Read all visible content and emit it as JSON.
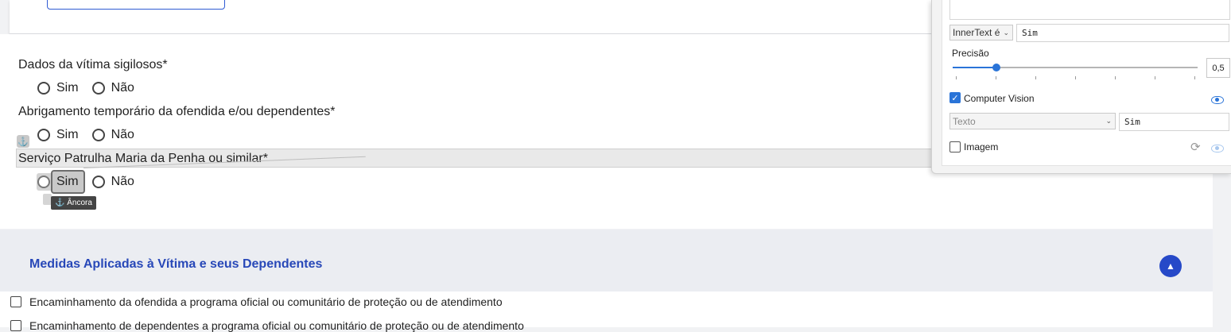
{
  "form": {
    "q1": {
      "label": "Dados da vítima sigilosos*",
      "yes": "Sim",
      "no": "Não"
    },
    "q2": {
      "label": "Abrigamento temporário da ofendida e/ou dependentes*",
      "yes": "Sim",
      "no": "Não"
    },
    "q3": {
      "label": "Serviço Patrulha Maria da Penha ou similar*",
      "yes": "Sim",
      "no": "Não"
    },
    "anchor_tooltip": "⚓ Âncora"
  },
  "section": {
    "title": "Medidas Aplicadas à Vítima e seus Dependentes",
    "items": [
      "Encaminhamento da ofendida a programa oficial ou comunitário de proteção ou de atendimento",
      "Encaminhamento de dependentes a programa oficial ou comunitário de proteção ou de atendimento"
    ]
  },
  "panel": {
    "match_select": "InnerText é",
    "match_value": "Sim",
    "precision_label": "Precisão",
    "precision_value": "0,5",
    "precision_fraction": 0.18,
    "cv_label": "Computer Vision",
    "cv_checked": true,
    "cv_select": "Texto",
    "cv_value": "Sim",
    "image_label": "Imagem",
    "image_checked": false
  }
}
